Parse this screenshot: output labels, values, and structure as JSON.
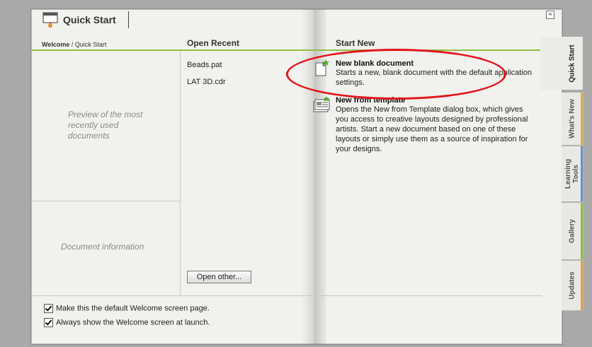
{
  "header": {
    "title": "Quick Start",
    "breadcrumb_current": "Welcome",
    "breadcrumb_sep": " / ",
    "breadcrumb_page": "Quick Start",
    "close_glyph": "×"
  },
  "columns": {
    "open_recent": "Open Recent",
    "start_new": "Start New"
  },
  "preview": {
    "placeholder": "Preview of the most recently used documents",
    "document_info": "Document information"
  },
  "recent_files": [
    "Beads.pat",
    "LAT 3D.cdr"
  ],
  "open_other_label": "Open other...",
  "start_new_items": [
    {
      "title": "New blank document",
      "description": "Starts a new, blank document with the default application settings.",
      "icon": "new-document-icon"
    },
    {
      "title": "New from template",
      "description": "Opens the New from Template dialog box, which gives you access to creative layouts designed by professional artists. Start a new document based on one of these layouts or simply use them as a source of inspiration for your designs.",
      "icon": "template-icon"
    }
  ],
  "options": [
    {
      "label": "Make this the default Welcome screen page.",
      "checked": true
    },
    {
      "label": "Always show the Welcome screen at launch.",
      "checked": true
    }
  ],
  "tabs": [
    {
      "label": "Quick Start",
      "accent": "#ebebe7",
      "active": true
    },
    {
      "label": "What's New",
      "accent": "#d8b24a"
    },
    {
      "label": "Learning Tools",
      "accent": "#6b8fd0"
    },
    {
      "label": "Gallery",
      "accent": "#8fc045"
    },
    {
      "label": "Updates",
      "accent": "#e0a34c"
    }
  ],
  "colors": {
    "accent_green": "#8fc045",
    "highlight_red": "#e3141b"
  }
}
